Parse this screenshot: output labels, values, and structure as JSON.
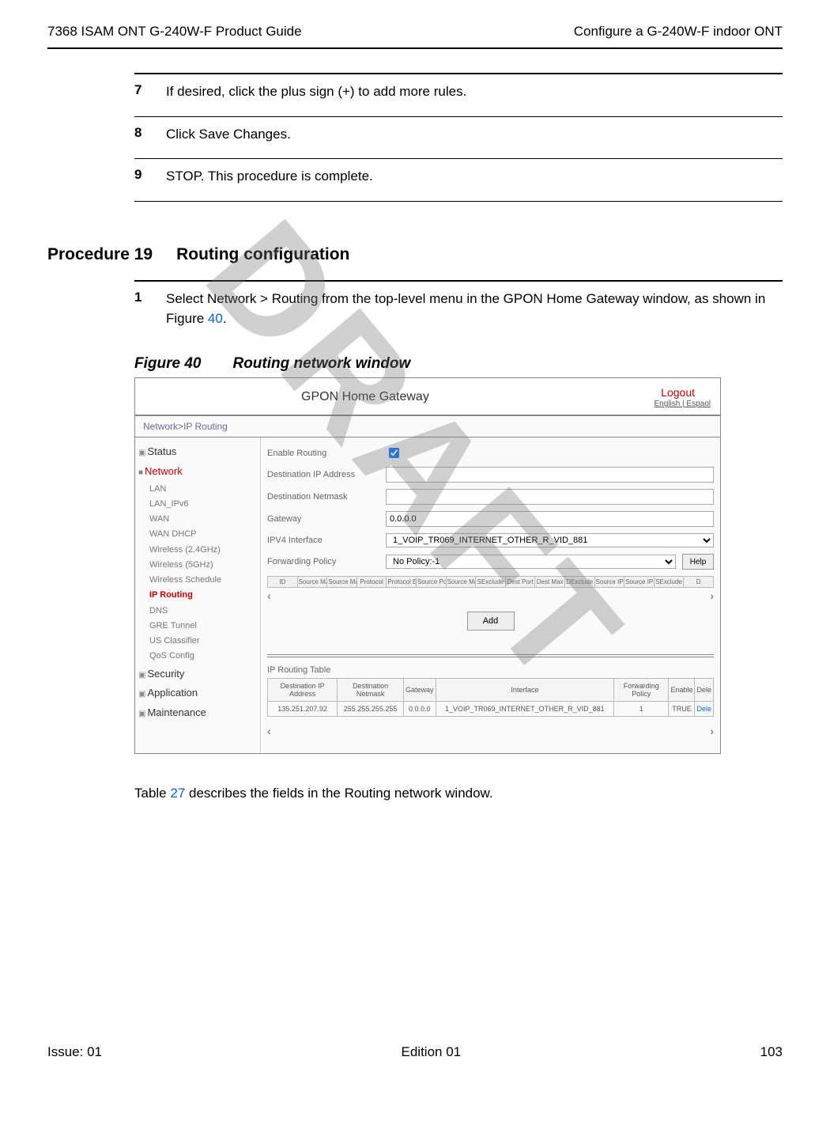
{
  "header": {
    "left": "7368 ISAM ONT G-240W-F Product Guide",
    "right": "Configure a G-240W-F indoor ONT"
  },
  "watermark": "DRAFT",
  "steps_cont": [
    {
      "num": "7",
      "text": "If desired, click the plus sign (+) to add more rules."
    },
    {
      "num": "8",
      "text": "Click Save Changes."
    },
    {
      "num": "9",
      "text": "STOP. This procedure is complete."
    }
  ],
  "procedure": {
    "label": "Procedure 19",
    "title": "Routing configuration",
    "step1_num": "1",
    "step1_text_a": "Select Network > Routing from the top-level menu in the GPON Home Gateway window, as shown in Figure ",
    "step1_fig_link": "40",
    "step1_text_b": "."
  },
  "figure": {
    "label": "Figure 40",
    "title": "Routing network window"
  },
  "screenshot": {
    "top": {
      "title": "GPON Home Gateway",
      "logout": "Logout",
      "lang": "English | Espaol"
    },
    "breadcrumb": "Network>IP Routing",
    "nav": {
      "items": [
        {
          "type": "top",
          "label": "Status",
          "icon": "▣"
        },
        {
          "type": "top",
          "label": "Network",
          "icon": "■",
          "active": true
        },
        {
          "type": "sub",
          "label": "LAN"
        },
        {
          "type": "sub",
          "label": "LAN_IPv6"
        },
        {
          "type": "sub",
          "label": "WAN"
        },
        {
          "type": "sub",
          "label": "WAN DHCP"
        },
        {
          "type": "sub",
          "label": "Wireless (2.4GHz)"
        },
        {
          "type": "sub",
          "label": "Wireless (5GHz)"
        },
        {
          "type": "sub",
          "label": "Wireless Schedule"
        },
        {
          "type": "sub",
          "label": "IP Routing",
          "active": true
        },
        {
          "type": "sub",
          "label": "DNS"
        },
        {
          "type": "sub",
          "label": "GRE Tunnel"
        },
        {
          "type": "sub",
          "label": "US Classifier"
        },
        {
          "type": "sub",
          "label": "QoS Config"
        },
        {
          "type": "top",
          "label": "Security",
          "icon": "▣"
        },
        {
          "type": "top",
          "label": "Application",
          "icon": "▣"
        },
        {
          "type": "top",
          "label": "Maintenance",
          "icon": "▣"
        }
      ]
    },
    "form": {
      "enable_routing": "Enable Routing",
      "dest_ip": "Destination IP Address",
      "dest_netmask": "Destination Netmask",
      "gateway_label": "Gateway",
      "gateway_value": "0.0.0.0",
      "ipv4_iface_label": "IPV4 Interface",
      "ipv4_iface_value": "1_VOIP_TR069_INTERNET_OTHER_R_VID_881",
      "fwd_policy_label": "Forwarding Policy",
      "fwd_policy_value": "No Policy:-1",
      "help": "Help"
    },
    "mini_headers": [
      "ID",
      "Source MAC",
      "Source MAC Exclude",
      "Protocol",
      "Protocol Exclude",
      "Source Port",
      "Source Max",
      "SExclude",
      "Dest Port",
      "Dest Max",
      "DExclude",
      "Source IP",
      "Source IP Mask",
      "SExclude",
      "D"
    ],
    "add_label": "Add",
    "routing_table_label": "IP Routing Table",
    "rt_headers": [
      "Destination IP Address",
      "Destination Netmask",
      "Gateway",
      "Interface",
      "Forwarding Policy",
      "Enable",
      "Dele"
    ],
    "rt_row": [
      "135.251.207.92",
      "255.255.255.255",
      "0.0.0.0",
      "1_VOIP_TR069_INTERNET_OTHER_R_VID_881",
      "1",
      "TRUE",
      "Dele"
    ]
  },
  "after_fig": {
    "text_a": "Table ",
    "link": "27",
    "text_b": " describes the fields in the Routing network window."
  },
  "footer": {
    "left": "Issue: 01",
    "center": "Edition 01",
    "right": "103"
  }
}
